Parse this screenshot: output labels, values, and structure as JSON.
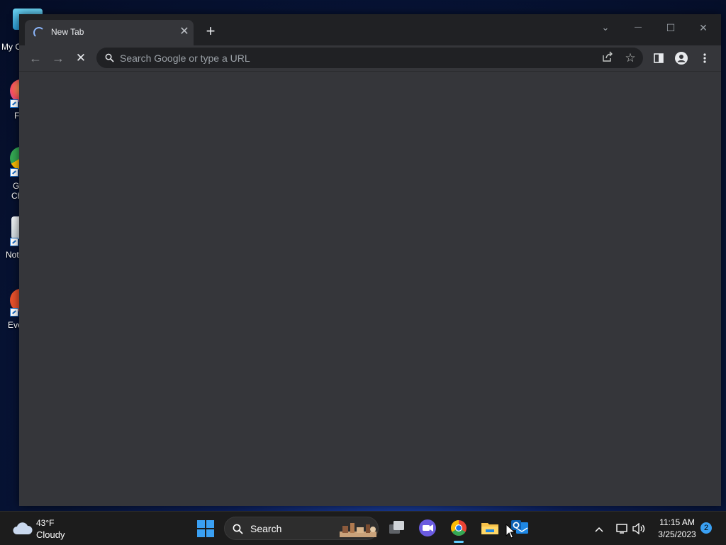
{
  "desktop": {
    "icons": [
      {
        "label": "My C",
        "icon": "this-pc-icon",
        "color": "#4cc2e8"
      },
      {
        "label": "F",
        "icon": "firefox-icon",
        "color": "#ff7139"
      },
      {
        "label": "G",
        "label2": "Ch",
        "icon": "chrome-icon",
        "color": "#34a853"
      },
      {
        "label": "Not",
        "icon": "notepad-icon",
        "color": "#dfe6ea"
      },
      {
        "label": "Eve",
        "icon": "everything-icon",
        "color": "#e8512c"
      }
    ]
  },
  "browser": {
    "tab": {
      "title": "New Tab",
      "loading": true,
      "close_glyph": "✕"
    },
    "new_tab_glyph": "+",
    "window_controls": {
      "tab_search": "⌄",
      "minimize": "—",
      "maximize": "☐",
      "close": "✕"
    },
    "nav": {
      "back": "←",
      "forward": "→",
      "stop": "✕"
    },
    "omnibox": {
      "placeholder": "Search Google or type a URL",
      "value": ""
    },
    "toolbar_icons": [
      "share-icon",
      "bookmark-star-icon",
      "side-panel-icon",
      "profile-icon",
      "menu-icon"
    ],
    "colors": {
      "frame": "#202124",
      "toolbar": "#35363a",
      "omnibox": "#202124",
      "accent": "#8ab4f8"
    }
  },
  "taskbar": {
    "weather": {
      "temp": "43°F",
      "condition": "Cloudy"
    },
    "search_label": "Search",
    "apps": [
      "task-view-icon",
      "teams-chat-icon",
      "chrome-icon",
      "file-explorer-icon",
      "outlook-icon"
    ],
    "active_app": "chrome-icon",
    "clock": {
      "time": "11:15 AM",
      "date": "3/25/2023"
    },
    "notifications": "2",
    "tray_icons": [
      "chevron-up-icon",
      "network-icon",
      "volume-icon"
    ]
  }
}
